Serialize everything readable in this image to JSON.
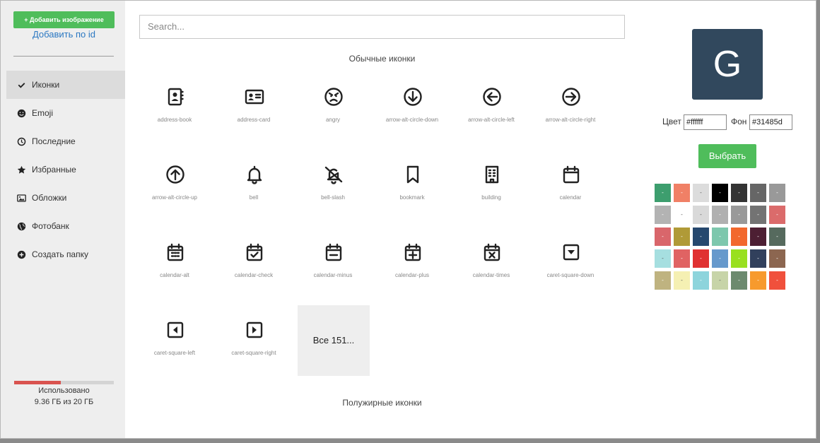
{
  "sidebar": {
    "add_image": "+ Добавить изображение",
    "add_by_id": "Добавить по id",
    "items": [
      {
        "label": "Иконки",
        "icon": "check-icon"
      },
      {
        "label": "Emoji",
        "icon": "smile-icon"
      },
      {
        "label": "Последние",
        "icon": "clock-icon"
      },
      {
        "label": "Избранные",
        "icon": "star-icon"
      },
      {
        "label": "Обложки",
        "icon": "image-icon"
      },
      {
        "label": "Фотобанк",
        "icon": "globe-icon"
      },
      {
        "label": "Создать папку",
        "icon": "plus-circle-icon"
      }
    ],
    "usage_label": "Использовано",
    "usage_value": "9.36 ГБ из 20 ГБ",
    "usage_fraction": 0.468
  },
  "search": {
    "placeholder": "Search..."
  },
  "sections": {
    "regular": "Обычные иконки",
    "bold": "Полужирные иконки"
  },
  "icons": [
    "address-book",
    "address-card",
    "angry",
    "arrow-alt-circle-down",
    "arrow-alt-circle-left",
    "arrow-alt-circle-right",
    "arrow-alt-circle-up",
    "bell",
    "bell-slash",
    "bookmark",
    "building",
    "calendar",
    "calendar-alt",
    "calendar-check",
    "calendar-minus",
    "calendar-plus",
    "calendar-times",
    "caret-square-down",
    "caret-square-left",
    "caret-square-right"
  ],
  "more": "Все 151...",
  "preview": {
    "letter": "G",
    "color_label": "Цвет",
    "color_value": "#ffffff",
    "bg_label": "Фон",
    "bg_value": "#31485d",
    "bg_hex": "#31485d"
  },
  "choose_button": "Выбрать",
  "swatch_label": "-",
  "swatches": [
    [
      "#3d9e6e",
      "#f08066",
      "#dcdcdc",
      "#000000",
      "#333333",
      "#666666",
      "#999999"
    ],
    [
      "#b3b3b3",
      "#ffffff",
      "#d9d9d9",
      "#b0b0b0",
      "#999999",
      "#737373",
      "#db6b6b"
    ],
    [
      "#d9666b",
      "#b09a37",
      "#26486e",
      "#7dc7ad",
      "#f2682d",
      "#4d1f33",
      "#566a5e"
    ],
    [
      "#a6dfe0",
      "#e06363",
      "#e03131",
      "#6699cc",
      "#99e01f",
      "#31405c",
      "#8c6650"
    ],
    [
      "#bfb380",
      "#f5f0b3",
      "#8dd4dc",
      "#c7d4a8",
      "#6c8a6e",
      "#f79a2d",
      "#f0503c"
    ]
  ]
}
